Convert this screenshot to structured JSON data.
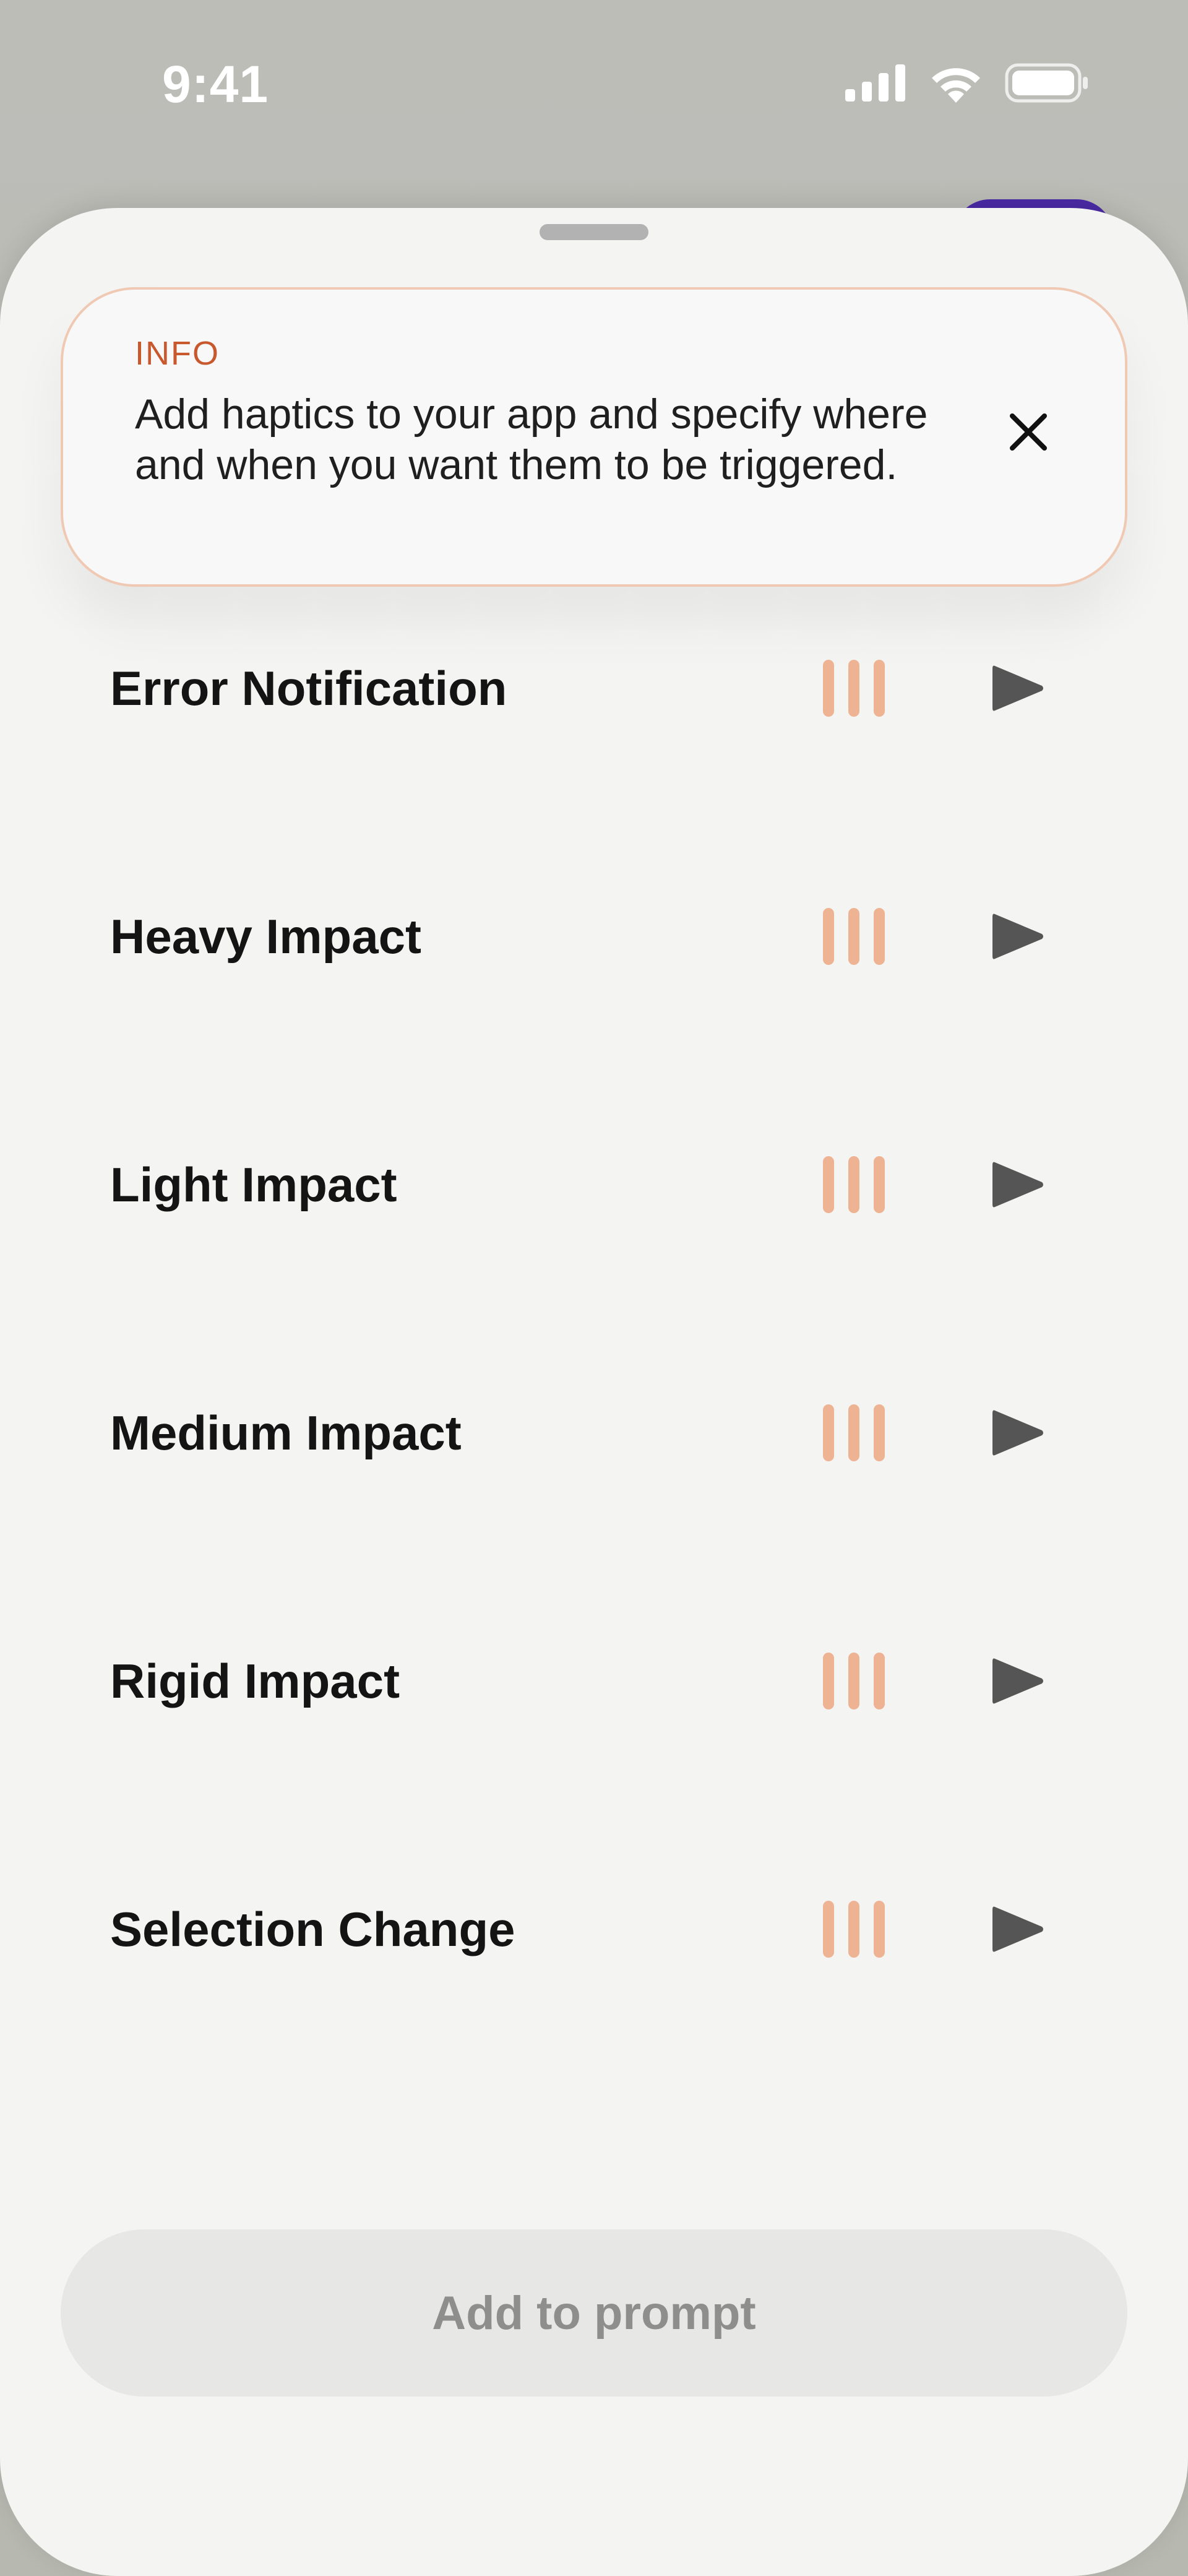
{
  "status_bar": {
    "time": "9:41",
    "icons": [
      "signal-icon",
      "wifi-icon",
      "battery-icon"
    ]
  },
  "info_banner": {
    "label": "INFO",
    "text": "Add haptics to your app and specify where and when you want them to be triggered.",
    "close_icon": "close-icon",
    "accent_color": "#c8582e",
    "border_color": "#f0c9b4"
  },
  "haptics": {
    "items": [
      {
        "label": "Error Notification",
        "icon": "haptic-bars-icon",
        "action_icon": "play-icon"
      },
      {
        "label": "Heavy Impact",
        "icon": "haptic-bars-icon",
        "action_icon": "play-icon"
      },
      {
        "label": "Light Impact",
        "icon": "haptic-bars-icon",
        "action_icon": "play-icon"
      },
      {
        "label": "Medium Impact",
        "icon": "haptic-bars-icon",
        "action_icon": "play-icon"
      },
      {
        "label": "Rigid Impact",
        "icon": "haptic-bars-icon",
        "action_icon": "play-icon"
      },
      {
        "label": "Selection Change",
        "icon": "haptic-bars-icon",
        "action_icon": "play-icon"
      }
    ],
    "bar_color": "#eeb393"
  },
  "footer": {
    "add_button_label": "Add to prompt"
  }
}
